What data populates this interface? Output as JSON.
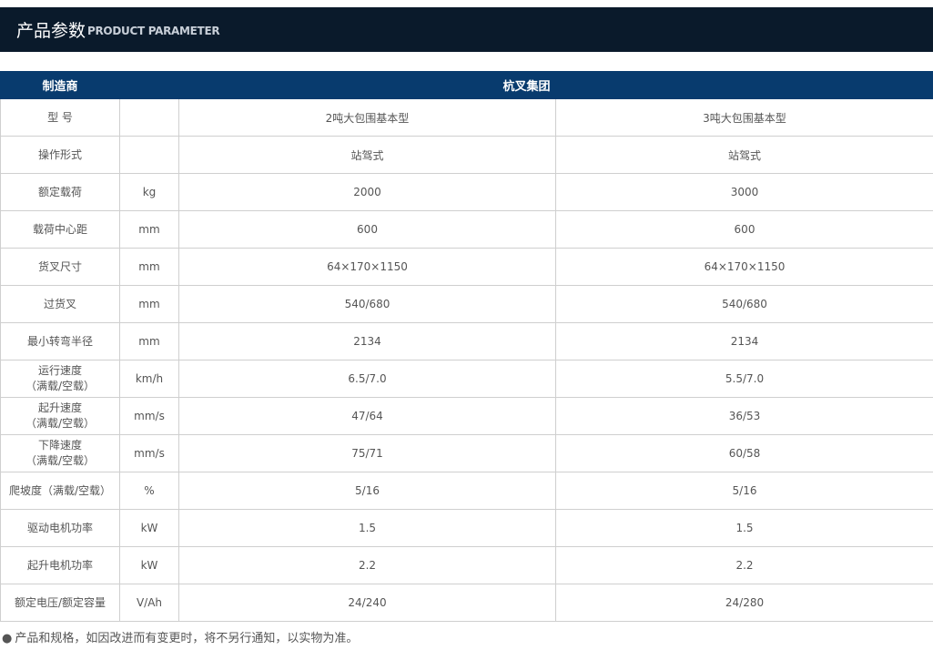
{
  "banner": {
    "title_cn": "产品参数",
    "title_en": "PRODUCT PARAMETER"
  },
  "table": {
    "header": {
      "label": "制造商",
      "value": "杭叉集团"
    },
    "rows": [
      {
        "label": "型 号",
        "unit": "",
        "v1": "2吨大包围基本型",
        "v2": "3吨大包围基本型"
      },
      {
        "label": "操作形式",
        "unit": "",
        "v1": "站驾式",
        "v2": "站驾式"
      },
      {
        "label": "额定载荷",
        "unit": "kg",
        "v1": "2000",
        "v2": "3000"
      },
      {
        "label": "载荷中心距",
        "unit": "mm",
        "v1": "600",
        "v2": "600"
      },
      {
        "label": "货叉尺寸",
        "unit": "mm",
        "v1": "64×170×1150",
        "v2": "64×170×1150"
      },
      {
        "label": "过货叉",
        "unit": "mm",
        "v1": "540/680",
        "v2": "540/680"
      },
      {
        "label": "最小转弯半径",
        "unit": "mm",
        "v1": "2134",
        "v2": "2134"
      },
      {
        "label": "运行速度",
        "label2": "（满载/空载）",
        "unit": "km/h",
        "v1": "6.5/7.0",
        "v2": "5.5/7.0"
      },
      {
        "label": "起升速度",
        "label2": "（满载/空载）",
        "unit": "mm/s",
        "v1": "47/64",
        "v2": "36/53"
      },
      {
        "label": "下降速度",
        "label2": "（满载/空载）",
        "unit": "mm/s",
        "v1": "75/71",
        "v2": "60/58"
      },
      {
        "label": "爬坡度（满载/空载）",
        "unit": "%",
        "v1": "5/16",
        "v2": "5/16"
      },
      {
        "label": "驱动电机功率",
        "unit": "kW",
        "v1": "1.5",
        "v2": "1.5"
      },
      {
        "label": "起升电机功率",
        "unit": "kW",
        "v1": "2.2",
        "v2": "2.2"
      },
      {
        "label": "额定电压/额定容量",
        "unit": "V/Ah",
        "v1": "24/240",
        "v2": "24/280"
      }
    ]
  },
  "note": {
    "bullet": "●",
    "text": "产品和规格，如因改进而有变更时，将不另行通知，以实物为准。"
  }
}
